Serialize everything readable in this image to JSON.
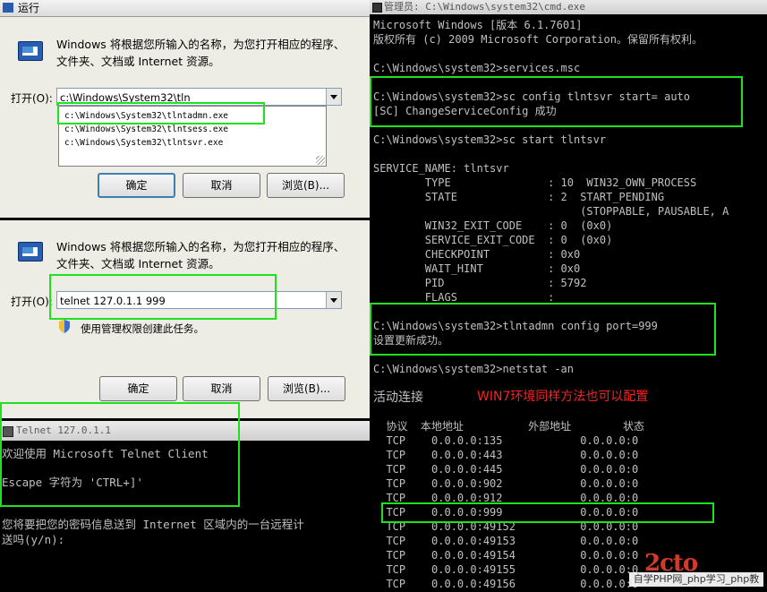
{
  "run_dialog_1": {
    "title": "运行",
    "description": "Windows 将根据您所输入的名称，为您打开相应的程序、\n文件夹、文档或 Internet 资源。",
    "open_label": "打开(O):",
    "input_value": "c:\\Windows\\System32\\tln",
    "dropdown_items": [
      "c:\\Windows\\System32\\tlntadmn.exe",
      "c:\\Windows\\System32\\tlntsess.exe",
      "c:\\Windows\\System32\\tlntsvr.exe"
    ],
    "ok_label": "确定",
    "cancel_label": "取消",
    "browse_label": "浏览(B)..."
  },
  "run_dialog_2": {
    "description": "Windows 将根据您所输入的名称，为您打开相应的程序、\n文件夹、文档或 Internet 资源。",
    "open_label": "打开(O):",
    "input_value": "telnet 127.0.1.1 999",
    "admin_text": "使用管理权限创建此任务。",
    "ok_label": "确定",
    "cancel_label": "取消",
    "browse_label": "浏览(B)..."
  },
  "telnet_window": {
    "title": "Telnet 127.0.1.1",
    "lines": [
      "欢迎使用 Microsoft Telnet Client",
      "",
      "Escape 字符为 'CTRL+]'",
      "",
      "",
      "您将要把您的密码信息送到 Internet 区域内的一台远程计",
      "送吗(y/n):"
    ]
  },
  "cmd_window": {
    "title": "管理员: C:\\Windows\\system32\\cmd.exe",
    "lines": [
      "Microsoft Windows [版本 6.1.7601]",
      "版权所有 (c) 2009 Microsoft Corporation。保留所有权利。",
      "",
      "C:\\Windows\\system32>services.msc",
      "",
      "C:\\Windows\\system32>sc config tlntsvr start= auto",
      "[SC] ChangeServiceConfig 成功",
      "",
      "C:\\Windows\\system32>sc start tlntsvr",
      "",
      "SERVICE_NAME: tlntsvr",
      "        TYPE               : 10  WIN32_OWN_PROCESS",
      "        STATE              : 2  START_PENDING",
      "                                (STOPPABLE, PAUSABLE, A",
      "        WIN32_EXIT_CODE    : 0  (0x0)",
      "        SERVICE_EXIT_CODE  : 0  (0x0)",
      "        CHECKPOINT         : 0x0",
      "        WAIT_HINT          : 0x0",
      "        PID                : 5792",
      "        FLAGS              :",
      "",
      "C:\\Windows\\system32>tlntadmn config port=999",
      "设置更新成功。",
      "",
      "C:\\Windows\\system32>netstat -an",
      "",
      "活动连接",
      "",
      "  协议  本地地址          外部地址        状态",
      "  TCP    0.0.0.0:135            0.0.0.0:0",
      "  TCP    0.0.0.0:443            0.0.0.0:0",
      "  TCP    0.0.0.0:445            0.0.0.0:0",
      "  TCP    0.0.0.0:902            0.0.0.0:0",
      "  TCP    0.0.0.0:912            0.0.0.0:0",
      "  TCP    0.0.0.0:999            0.0.0.0:0",
      "  TCP    0.0.0.0:49152          0.0.0.0:0",
      "  TCP    0.0.0.0:49153          0.0.0.0:0",
      "  TCP    0.0.0.0:49154          0.0.0.0:0",
      "  TCP    0.0.0.0:49155          0.0.0.0:0",
      "  TCP    0.0.0.0:49156          0.0.0.0:0"
    ],
    "note": "WIN7环境同样方法也可以配置"
  },
  "watermark": {
    "logo": "2cto",
    "text": "自学PHP网_php学习_php教"
  },
  "colors": {
    "highlight": "#1ee21e",
    "note": "#ff2020",
    "console_text": "#c0c0c0"
  }
}
